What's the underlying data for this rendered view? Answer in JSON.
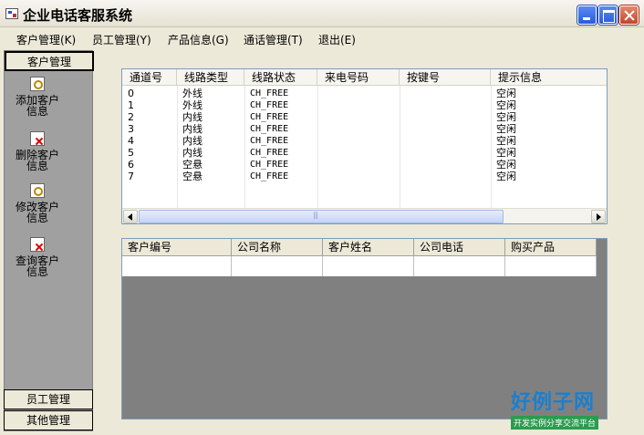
{
  "window": {
    "title": "企业电话客服系统"
  },
  "menu": [
    "客户管理(K)",
    "员工管理(Y)",
    "产品信息(G)",
    "通话管理(T)",
    "退出(E)"
  ],
  "nav": {
    "active_header": "客户管理",
    "items": [
      {
        "label": "添加客户信息",
        "icon": "search-doc-icon"
      },
      {
        "label": "删除客户信息",
        "icon": "delete-doc-icon"
      },
      {
        "label": "修改客户信息",
        "icon": "search-doc-icon"
      },
      {
        "label": "查询客户信息",
        "icon": "delete-doc-icon"
      }
    ],
    "bottom_headers": [
      "员工管理",
      "其他管理"
    ]
  },
  "channel_list": {
    "columns": [
      "通道号",
      "线路类型",
      "线路状态",
      "来电号码",
      "按键号",
      "提示信息"
    ],
    "rows": [
      [
        "0",
        "外线",
        "CH_FREE",
        "",
        "",
        "空闲"
      ],
      [
        "1",
        "外线",
        "CH_FREE",
        "",
        "",
        "空闲"
      ],
      [
        "2",
        "内线",
        "CH_FREE",
        "",
        "",
        "空闲"
      ],
      [
        "3",
        "内线",
        "CH_FREE",
        "",
        "",
        "空闲"
      ],
      [
        "4",
        "内线",
        "CH_FREE",
        "",
        "",
        "空闲"
      ],
      [
        "5",
        "内线",
        "CH_FREE",
        "",
        "",
        "空闲"
      ],
      [
        "6",
        "空悬",
        "CH_FREE",
        "",
        "",
        "空闲"
      ],
      [
        "7",
        "空悬",
        "CH_FREE",
        "",
        "",
        "空闲"
      ]
    ]
  },
  "customer_grid": {
    "columns": [
      "客户编号",
      "公司名称",
      "客户姓名",
      "公司电话",
      "购买产品"
    ]
  },
  "watermark": {
    "big": "好例子网",
    "small": "开发实例分享交流平台"
  }
}
